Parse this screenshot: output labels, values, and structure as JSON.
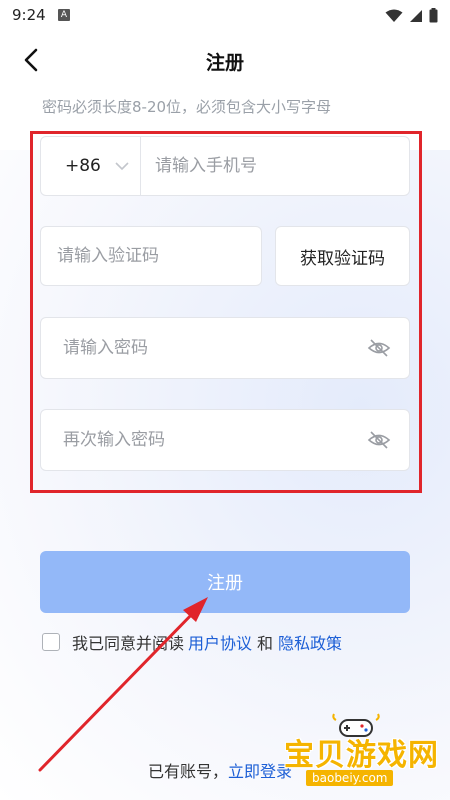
{
  "status": {
    "time": "9:24",
    "notification_glyph": "A"
  },
  "header": {
    "title": "注册"
  },
  "hint": "密码必须长度8-20位，必须包含大小写字母",
  "form": {
    "country_code": "+86",
    "phone_placeholder": "请输入手机号",
    "verify_placeholder": "请输入验证码",
    "get_code_label": "获取验证码",
    "password_placeholder": "请输入密码",
    "confirm_password_placeholder": "再次输入密码"
  },
  "register_label": "注册",
  "agreement": {
    "text": "我已同意并阅读",
    "user_agreement": "用户协议",
    "and": "和",
    "privacy_policy": "隐私政策"
  },
  "login": {
    "prompt": "已有账号，",
    "link": "立即登录"
  },
  "watermark": {
    "title": "宝贝游戏网",
    "url": "baobeiy.com"
  },
  "colors": {
    "accent": "#1d5fd6",
    "button": "#93b8f8",
    "highlight_border": "#e0252b",
    "watermark": "#f5b400"
  }
}
